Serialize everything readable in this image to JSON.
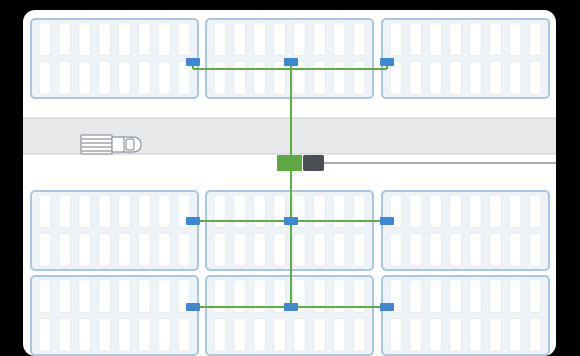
{
  "diagram": {
    "kind": "parking-lot-ev-charger-layout",
    "icons": {
      "vehicle": "pickup-truck-icon",
      "main_unit": "power-cabinet-icon",
      "connector": "grid-connection-icon",
      "charger": "charging-point-icon"
    },
    "colors": {
      "background": "#000000",
      "panel": "#ffffff",
      "block_fill": "#eef3f8",
      "block_border": "#a9c6e4",
      "stall_fill": "#ffffff",
      "stall_stroke": "#dfe6ee",
      "road": "#e6e8ea",
      "road_edge": "#c9cdd1",
      "cable": "#66aa44",
      "charger": "#3f87d3",
      "main_unit": "#5ea844",
      "connector": "#4b4f55",
      "grid_line": "#a8adb2",
      "truck_stroke": "#8e969e"
    },
    "parking_rows": 3,
    "parking_columns": 3,
    "stalls_per_block": 8,
    "charger_count": 9
  }
}
